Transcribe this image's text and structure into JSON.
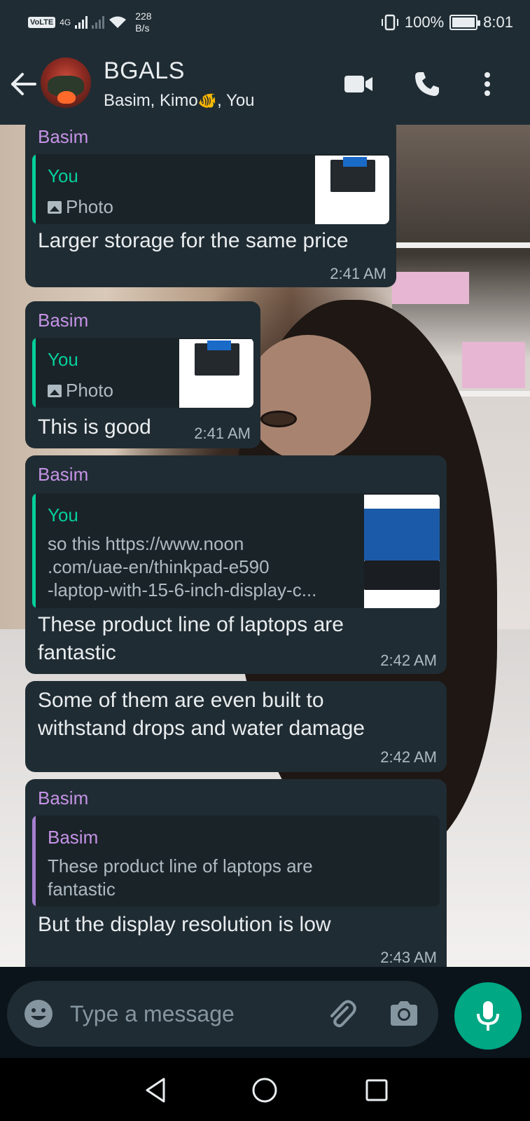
{
  "status_bar": {
    "volte": "VoLTE",
    "network": "4G",
    "net_speed_value": "228",
    "net_speed_unit": "B/s",
    "battery": "100%",
    "battery_level": 1.0,
    "time": "8:01"
  },
  "header": {
    "title": "BGALS",
    "members_prefix": "Basim, Kimo",
    "members_emoji": "🐠",
    "members_suffix": ", You",
    "icons": [
      "back-arrow-icon",
      "video-call-icon",
      "voice-call-icon",
      "more-options-icon"
    ]
  },
  "messages": [
    {
      "sender": "Basim",
      "quote_author": "You",
      "quote_type": "Photo",
      "text": "Larger storage for the same price",
      "time": "2:41 AM"
    },
    {
      "sender": "Basim",
      "quote_author": "You",
      "quote_type": "Photo",
      "text": "This is good",
      "time": "2:41 AM"
    },
    {
      "sender": "Basim",
      "quote_author": "You",
      "quote_line1": "so this https://www.noon",
      "quote_line2": ".com/uae-en/thinkpad-e590",
      "quote_line3": "-laptop-with-15-6-inch-display-c...",
      "text_line1": "These product line of laptops are",
      "text_line2": "fantastic",
      "time": "2:42 AM"
    },
    {
      "text_line1": "Some of them are even built to",
      "text_line2": "withstand drops and water damage",
      "time": "2:42 AM"
    },
    {
      "sender": "Basim",
      "quote_author": "Basim",
      "quote_line1": "These product line of laptops are",
      "quote_line2": "fantastic",
      "text": "But the display resolution is low",
      "time": "2:43 AM"
    }
  ],
  "input": {
    "placeholder": "Type a message"
  },
  "colors": {
    "bubble": "#202c33",
    "header": "#1f2c34",
    "sender_name": "#c493e6",
    "quote_you": "#06cf9c",
    "quote_other": "#a57fd0",
    "accent": "#00a884"
  }
}
